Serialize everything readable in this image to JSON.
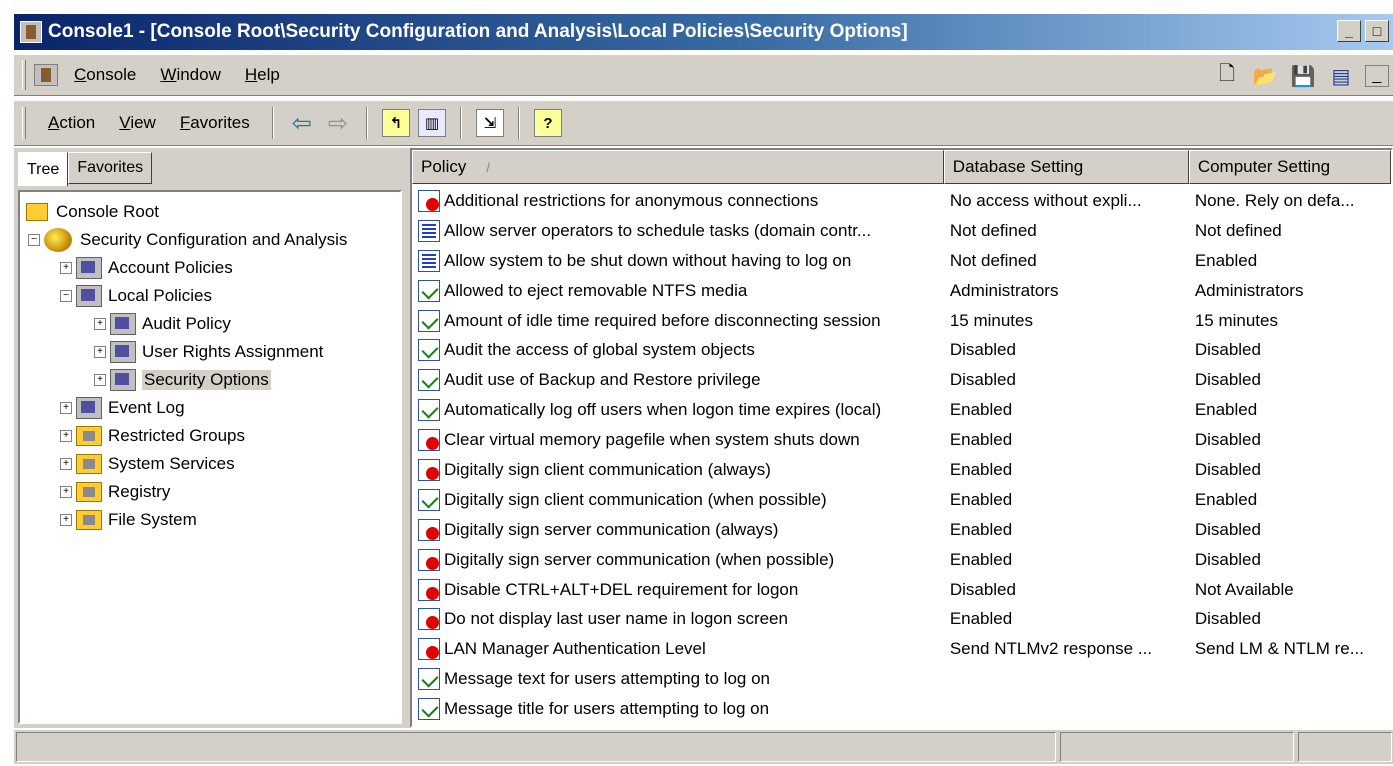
{
  "window": {
    "title": "Console1 - [Console Root\\Security Configuration and Analysis\\Local Policies\\Security Options]"
  },
  "menubar": {
    "items": [
      "Console",
      "Window",
      "Help"
    ]
  },
  "toolbar": {
    "items": [
      "Action",
      "View",
      "Favorites"
    ]
  },
  "tabs": [
    "Tree",
    "Favorites"
  ],
  "tree": {
    "root": "Console Root",
    "nodes": [
      {
        "label": "Security Configuration and Analysis",
        "level": 1
      },
      {
        "label": "Account Policies",
        "level": 2
      },
      {
        "label": "Local Policies",
        "level": 2
      },
      {
        "label": "Audit Policy",
        "level": 3
      },
      {
        "label": "User Rights Assignment",
        "level": 3
      },
      {
        "label": "Security Options",
        "level": 3
      },
      {
        "label": "Event Log",
        "level": 2
      },
      {
        "label": "Restricted Groups",
        "level": 2
      },
      {
        "label": "System Services",
        "level": 2
      },
      {
        "label": "Registry",
        "level": 2
      },
      {
        "label": "File System",
        "level": 2
      }
    ]
  },
  "list": {
    "columns": [
      "Policy",
      "Database Setting",
      "Computer Setting"
    ],
    "rows": [
      {
        "icon": "red",
        "policy": "Additional restrictions for anonymous connections",
        "db": "No access without expli...",
        "comp": "None. Rely on defa..."
      },
      {
        "icon": "blue",
        "policy": "Allow server operators to schedule tasks (domain contr...",
        "db": "Not defined",
        "comp": "Not defined"
      },
      {
        "icon": "blue",
        "policy": "Allow system to be shut down without having to log on",
        "db": "Not defined",
        "comp": "Enabled"
      },
      {
        "icon": "check",
        "policy": "Allowed to eject removable NTFS media",
        "db": "Administrators",
        "comp": "Administrators"
      },
      {
        "icon": "check",
        "policy": "Amount of idle time required before disconnecting session",
        "db": "15 minutes",
        "comp": "15 minutes"
      },
      {
        "icon": "check",
        "policy": "Audit the access of global system objects",
        "db": "Disabled",
        "comp": "Disabled"
      },
      {
        "icon": "check",
        "policy": "Audit use of Backup and Restore privilege",
        "db": "Disabled",
        "comp": "Disabled"
      },
      {
        "icon": "check",
        "policy": "Automatically log off users when logon time expires (local)",
        "db": "Enabled",
        "comp": "Enabled"
      },
      {
        "icon": "red",
        "policy": "Clear virtual memory pagefile when system shuts down",
        "db": "Enabled",
        "comp": "Disabled"
      },
      {
        "icon": "red",
        "policy": "Digitally sign client communication (always)",
        "db": "Enabled",
        "comp": "Disabled"
      },
      {
        "icon": "check",
        "policy": "Digitally sign client communication (when possible)",
        "db": "Enabled",
        "comp": "Enabled"
      },
      {
        "icon": "red",
        "policy": "Digitally sign server communication (always)",
        "db": "Enabled",
        "comp": "Disabled"
      },
      {
        "icon": "red",
        "policy": "Digitally sign server communication (when possible)",
        "db": "Enabled",
        "comp": "Disabled"
      },
      {
        "icon": "red",
        "policy": "Disable CTRL+ALT+DEL requirement for logon",
        "db": "Disabled",
        "comp": "Not Available"
      },
      {
        "icon": "red",
        "policy": "Do not display last user name in logon screen",
        "db": "Enabled",
        "comp": "Disabled"
      },
      {
        "icon": "red",
        "policy": "LAN Manager Authentication Level",
        "db": "Send NTLMv2 response ...",
        "comp": "Send LM & NTLM re..."
      },
      {
        "icon": "check",
        "policy": "Message text for users attempting to log on",
        "db": "",
        "comp": ""
      },
      {
        "icon": "check",
        "policy": "Message title for users attempting to log on",
        "db": "",
        "comp": ""
      }
    ]
  }
}
